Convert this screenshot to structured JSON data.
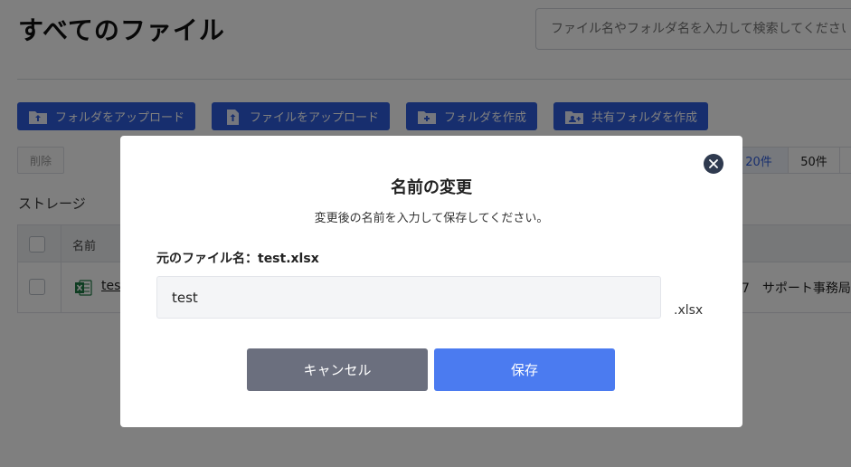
{
  "page": {
    "title": "すべてのファイル",
    "search_placeholder": "ファイル名やフォルダ名を入力して検索してください"
  },
  "toolbar": {
    "upload_folder": "フォルダをアップロード",
    "upload_file": "ファイルをアップロード",
    "create_folder": "フォルダを作成",
    "create_shared_folder": "共有フォルダを作成",
    "delete": "削除"
  },
  "per_page": {
    "options": [
      "20件",
      "50件"
    ],
    "selected": "20件"
  },
  "storage": {
    "label": "ストレージ",
    "columns": {
      "name": "名前"
    },
    "rows": [
      {
        "name": "test",
        "icon": "excel-file-icon",
        "trailing": "7　サポート事務局"
      }
    ]
  },
  "modal": {
    "title": "名前の変更",
    "description": "変更後の名前を入力して保存してください。",
    "original_name": "元のファイル名：test.xlsx",
    "input_value": "test",
    "extension": ".xlsx",
    "cancel": "キャンセル",
    "save": "保存"
  },
  "colors": {
    "primary": "#2f5ddc",
    "save": "#4b7bf0",
    "cancel": "#6b6f7e",
    "overlay": "rgba(0,0,0,0.5)",
    "close": "#2f3a4f"
  }
}
